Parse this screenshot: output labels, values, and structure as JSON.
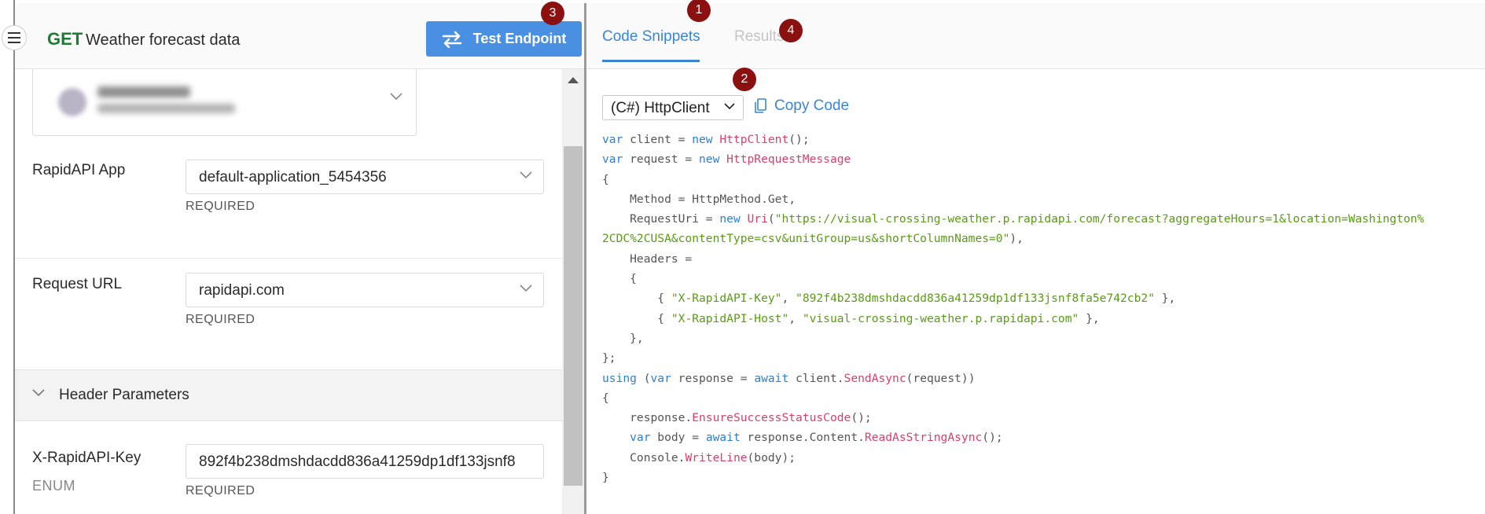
{
  "header": {
    "method": "GET",
    "endpoint_name": "Weather forecast data",
    "test_button_label": "Test Endpoint"
  },
  "badges": {
    "one": "1",
    "two": "2",
    "three": "3",
    "four": "4"
  },
  "form": {
    "rapidapi_app": {
      "label": "RapidAPI App",
      "value": "default-application_5454356",
      "required": "REQUIRED"
    },
    "request_url": {
      "label": "Request URL",
      "value": "rapidapi.com",
      "required": "REQUIRED"
    },
    "header_parameters": {
      "label": "Header Parameters"
    },
    "api_key": {
      "label": "X-RapidAPI-Key",
      "type": "ENUM",
      "value": "892f4b238dmshdacdd836a41259dp1df133jsnf8",
      "required": "REQUIRED"
    }
  },
  "tabs": {
    "code_snippets": "Code Snippets",
    "results": "Results"
  },
  "snippet": {
    "language": "(C#) HttpClient",
    "copy_label": "Copy Code"
  },
  "code": {
    "l1_var": "var",
    "l1_client": " client = ",
    "l1_new": "new",
    "l1_type": " HttpClient",
    "l1_end": "();",
    "l2_var": "var",
    "l2_request": " request = ",
    "l2_new": "new",
    "l2_type": " HttpRequestMessage",
    "l3": "{",
    "l4": "    Method = HttpMethod.Get,",
    "l5_a": "    RequestUri = ",
    "l5_new": "new",
    "l5_type": " Uri",
    "l5_b": "(",
    "l5_str": "\"https://visual-crossing-weather.p.rapidapi.com/forecast?aggregateHours=1&location=Washington%",
    "l6_str": "2CDC%2CUSA&contentType=csv&unitGroup=us&shortColumnNames=0\"",
    "l6_end": "),",
    "l7": "    Headers =",
    "l8": "    {",
    "l9_a": "        { ",
    "l9_k": "\"X-RapidAPI-Key\"",
    "l9_b": ", ",
    "l9_v": "\"892f4b238dmshdacdd836a41259dp1df133jsnf8fa5e742cb2\"",
    "l9_c": " },",
    "l10_a": "        { ",
    "l10_k": "\"X-RapidAPI-Host\"",
    "l10_b": ", ",
    "l10_v": "\"visual-crossing-weather.p.rapidapi.com\"",
    "l10_c": " },",
    "l11": "    },",
    "l12": "};",
    "l13_using": "using",
    "l13_a": " (",
    "l13_var": "var",
    "l13_b": " response = ",
    "l13_await": "await",
    "l13_c": " client.",
    "l13_fn": "SendAsync",
    "l13_d": "(request))",
    "l14": "{",
    "l15_a": "    response.",
    "l15_fn": "EnsureSuccessStatusCode",
    "l15_b": "();",
    "l16_a": "    ",
    "l16_var": "var",
    "l16_b": " body = ",
    "l16_await": "await",
    "l16_c": " response.Content.",
    "l16_fn": "ReadAsStringAsync",
    "l16_d": "();",
    "l17_a": "    Console.",
    "l17_fn": "WriteLine",
    "l17_b": "(body);",
    "l18": "}"
  },
  "colors": {
    "accent_blue": "#4a90e2",
    "method_green": "#1e7b34",
    "badge_red": "#8b1111",
    "code_keyword": "#2f7fcf",
    "code_type": "#d6416b",
    "code_string": "#5b9a18"
  },
  "icons": {
    "menu": "hamburger-menu-icon",
    "test": "swap-arrows-icon",
    "copy": "copy-icon",
    "chevron": "chevron-down-icon",
    "scroll": "scroll-up-arrow-icon"
  }
}
